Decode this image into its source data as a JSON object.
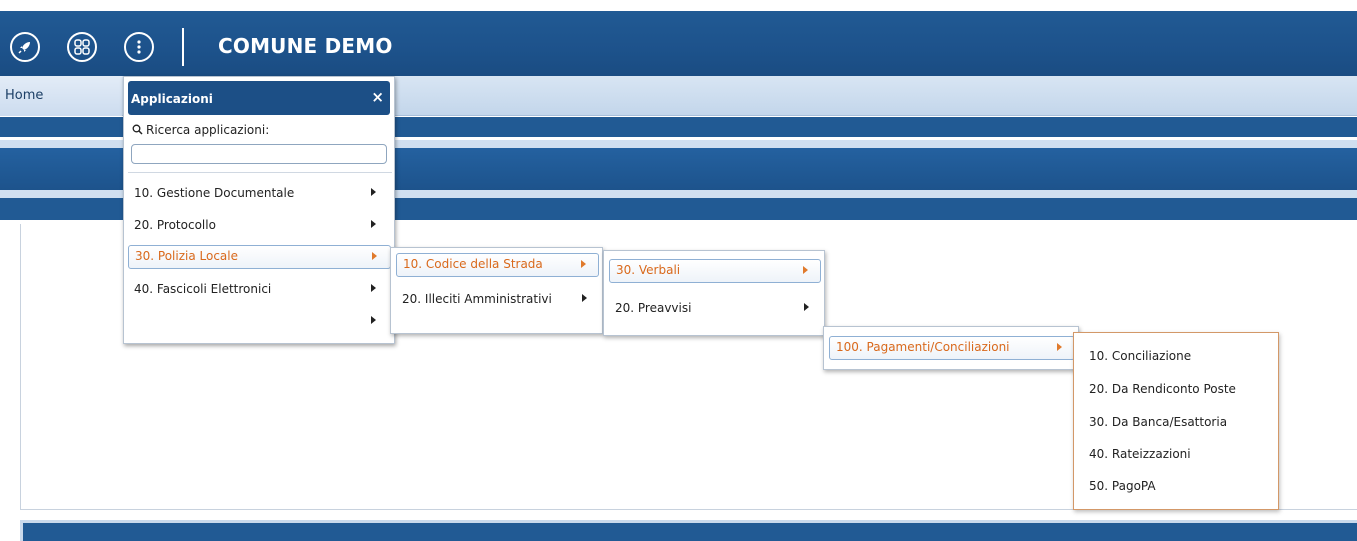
{
  "header": {
    "title": "COMUNE DEMO",
    "icons": [
      "rocket-icon",
      "apps-grid-icon",
      "more-vertical-icon"
    ]
  },
  "nav": {
    "home_label": "Home"
  },
  "app_menu": {
    "title": "Applicazioni",
    "close_label": "×",
    "search_label": "Ricerca applicazioni:",
    "search_value": "",
    "items": [
      {
        "label": "10. Gestione Documentale"
      },
      {
        "label": "20. Protocollo"
      },
      {
        "label": "30. Polizia Locale",
        "active": true
      },
      {
        "label": "40. Fascicoli Elettronici"
      },
      {
        "label": ""
      }
    ]
  },
  "submenu_level1": {
    "items": [
      {
        "label": "10. Codice della Strada",
        "active": true
      },
      {
        "label": "20. Illeciti Amministrativi"
      }
    ]
  },
  "submenu_level2": {
    "items": [
      {
        "label": "30. Verbali",
        "active": true
      },
      {
        "label": "20. Preavvisi"
      }
    ]
  },
  "submenu_level3": {
    "items": [
      {
        "label": "100. Pagamenti/Conciliazioni",
        "active": true
      }
    ]
  },
  "submenu_level4": {
    "items": [
      {
        "label": "10. Conciliazione"
      },
      {
        "label": "20. Da Rendiconto Poste"
      },
      {
        "label": "30. Da Banca/Esattoria"
      },
      {
        "label": "40. Rateizzazioni"
      },
      {
        "label": "50. PagoPA"
      }
    ]
  },
  "colors": {
    "header_blue": "#215a94",
    "active_text": "#d9691c"
  }
}
